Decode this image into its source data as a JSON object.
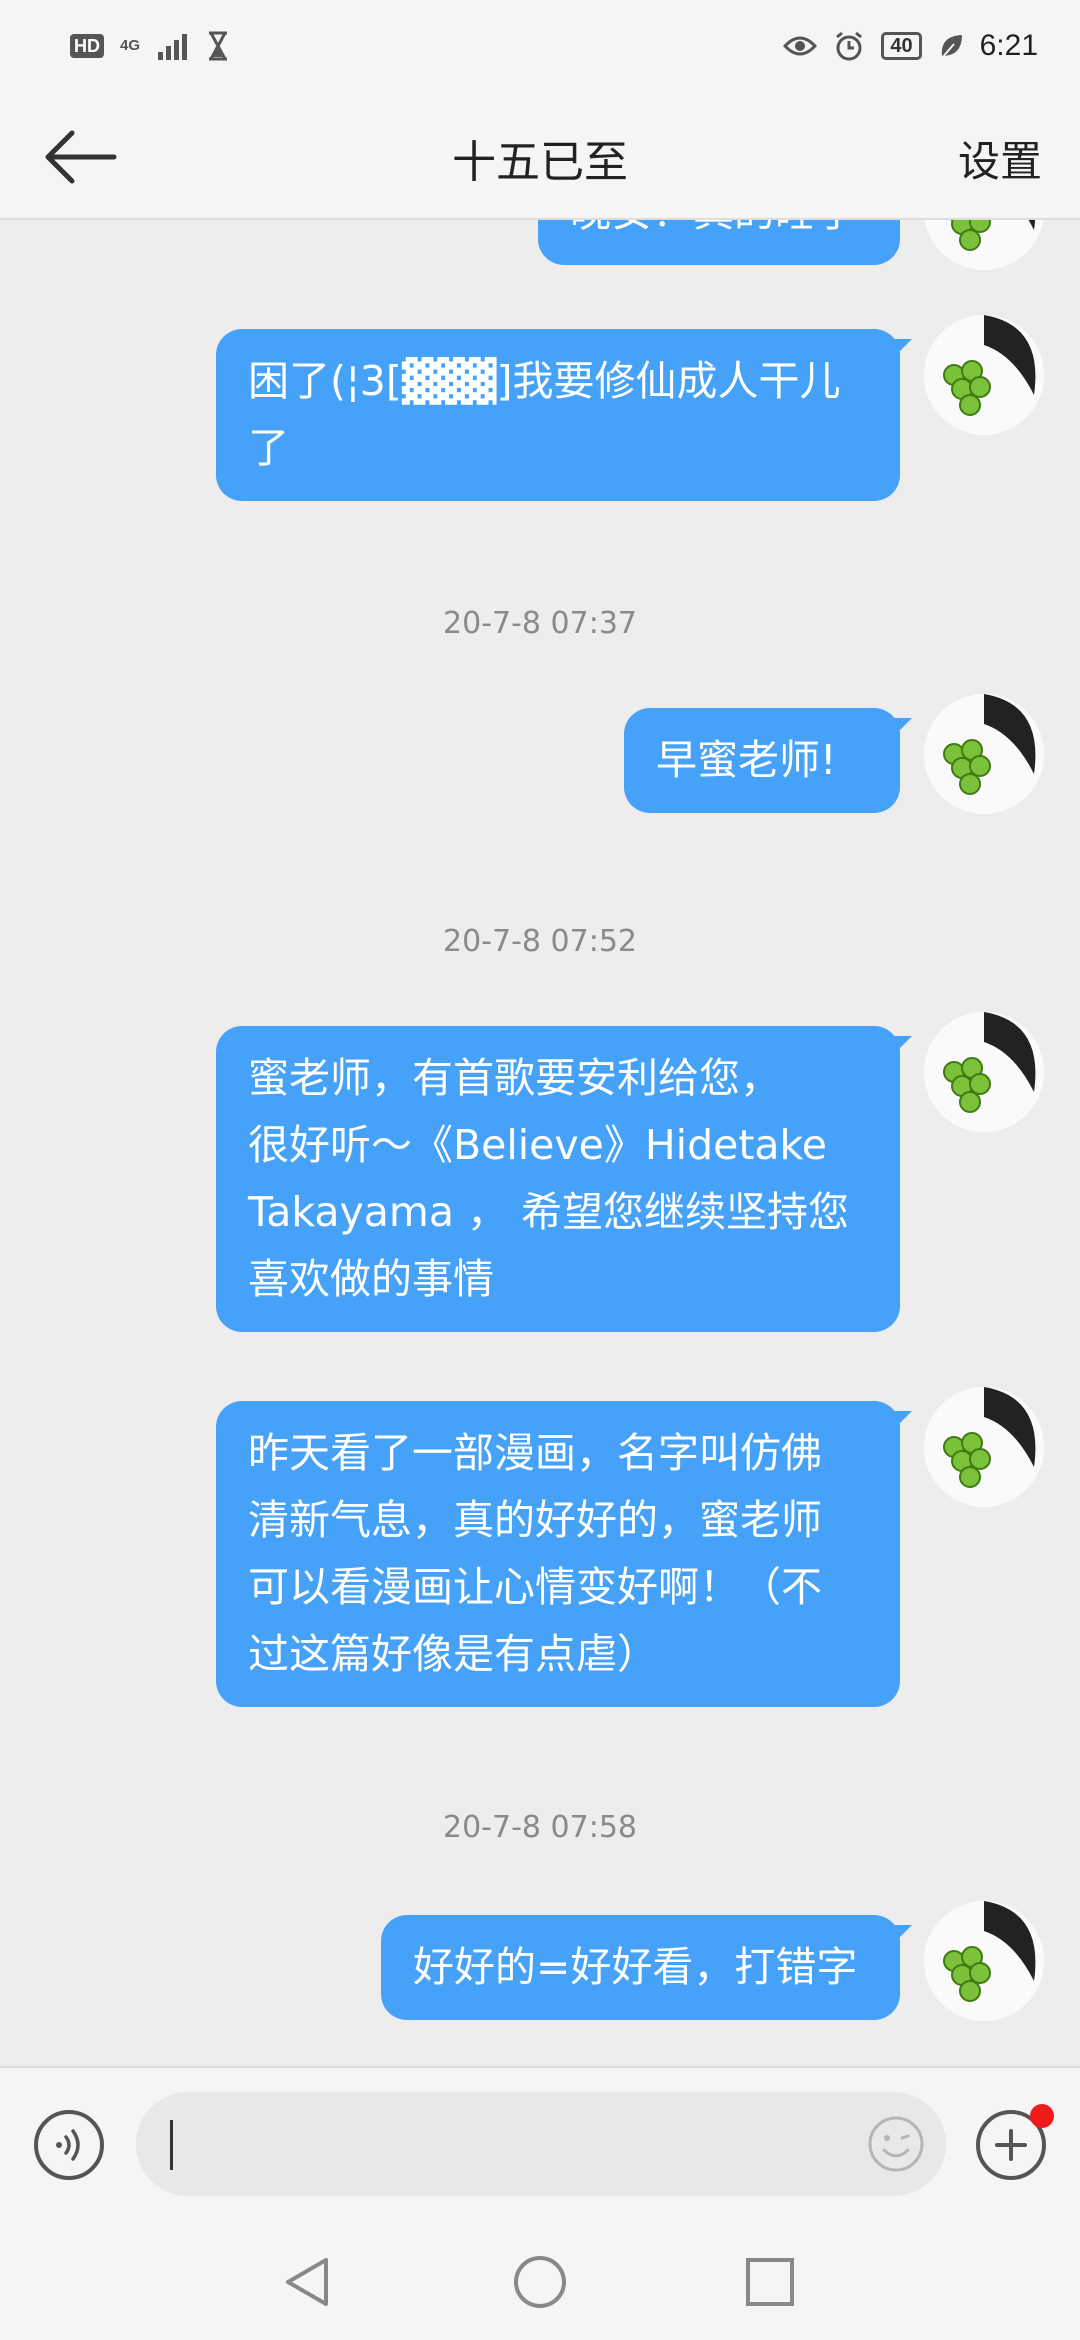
{
  "status_bar": {
    "hd": "HD",
    "network": "4G",
    "battery": "40",
    "time": "6:21"
  },
  "header": {
    "title": "十五已至",
    "settings_label": "设置"
  },
  "messages": [
    {
      "type": "bubble",
      "text": "晚安！真的睡了"
    },
    {
      "type": "bubble",
      "text": "困了(¦3[▓▓▓]我要修仙成人干儿\n了"
    },
    {
      "type": "timestamp",
      "text": "20-7-8 07:37"
    },
    {
      "type": "bubble",
      "text": "早蜜老师!"
    },
    {
      "type": "timestamp",
      "text": "20-7-8 07:52"
    },
    {
      "type": "bubble",
      "text": "蜜老师，有首歌要安利给您，\n很好听～《Believe》Hidetake\nTakayama ， 希望您继续坚持您\n喜欢做的事情"
    },
    {
      "type": "bubble",
      "text": "昨天看了一部漫画，名字叫仿佛\n清新气息，真的好好的，蜜老师\n可以看漫画让心情变好啊！（不\n过这篇好像是有点虐）"
    },
    {
      "type": "timestamp",
      "text": "20-7-8 07:58"
    },
    {
      "type": "bubble",
      "text": "好好的=好好看，打错字"
    }
  ],
  "input": {
    "value": "",
    "placeholder": ""
  },
  "icons": {
    "back": "arrow-left-icon",
    "voice": "voice-icon",
    "emoji": "smiley-icon",
    "plus": "plus-icon",
    "nav_back": "triangle-back-icon",
    "nav_home": "circle-home-icon",
    "nav_recents": "square-recents-icon"
  },
  "colors": {
    "bubble": "#46a2f9",
    "background": "#ededed",
    "notify_dot": "#f01b1b"
  }
}
